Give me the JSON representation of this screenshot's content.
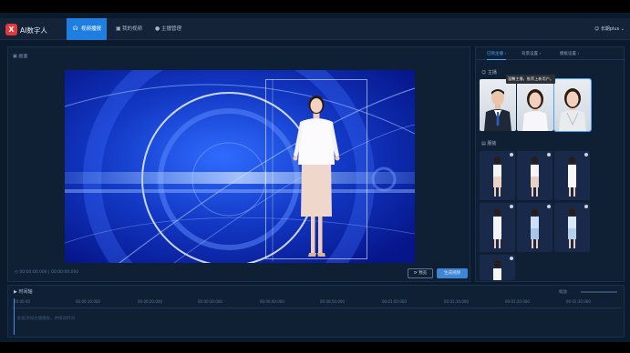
{
  "app": {
    "logo": "X",
    "title": "AI数字人"
  },
  "nav": [
    {
      "label": "视频播报",
      "icon": "headset-icon"
    },
    {
      "label": "我的视频",
      "icon": "video-icon"
    },
    {
      "label": "主播管理",
      "icon": "user-icon"
    }
  ],
  "user": {
    "name": "长期plus"
  },
  "workspace": {
    "title": "画面",
    "timecode": "00:00:00.000 | 00:00:00.000",
    "preview_label": "预览",
    "generate_label": "生成视频"
  },
  "panel": {
    "tabs": [
      "已购主播",
      "背景设置",
      "模板设置"
    ],
    "anchor_section": "主播",
    "outfit_section": "服装",
    "tooltip": "温馨主播，推荐上新用户。"
  },
  "timeline": {
    "title": "时间轴",
    "tools": "缩放",
    "ticks": [
      "00:00:00",
      "00:00:10:000",
      "00:00:20:000",
      "00:00:30:000",
      "00:00:40:000",
      "00:00:50:000",
      "00:01:00:000",
      "00:01:10:000",
      "00:01:20:000",
      "00:01:30:000"
    ],
    "hint": "此处添加主播播报，并拖动时间"
  },
  "colors": {
    "accent": "#1f7fe0",
    "canvas": "#0a2aa0",
    "bg": "#0b1a2c"
  }
}
